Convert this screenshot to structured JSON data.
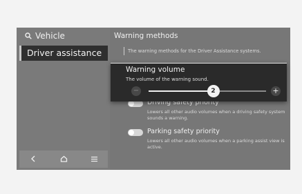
{
  "sidebar": {
    "title": "Vehicle",
    "search_icon": "search-icon",
    "items": [
      {
        "label": "Driver assistance",
        "selected": true
      }
    ],
    "footer": {
      "back_icon": "chevron-left-icon",
      "home_icon": "home-icon",
      "menu_icon": "menu-icon"
    }
  },
  "main": {
    "title": "Warning methods",
    "description": "The warning methods for the Driver Assistance systems.",
    "options": [
      {
        "label": "Driving safety priority",
        "description": "Lowers all other audio volumes when a driving safety system sounds a warning.",
        "enabled": false
      },
      {
        "label": "Parking safety priority",
        "description": "Lowers all other audio volumes when a parking assist view is active.",
        "enabled": false
      }
    ]
  },
  "popup": {
    "title": "Warning volume",
    "description": "The volume of the warning sound.",
    "value": "2",
    "level_fraction": 0.55,
    "minus_label": "−",
    "plus_label": "+",
    "minus_enabled": false
  },
  "colors": {
    "screen_bg": "#777777",
    "selected_item_bg": "#2f2f2f",
    "popup_bg": "#2a2a2a",
    "toggle_off": "#d7d7d7"
  }
}
